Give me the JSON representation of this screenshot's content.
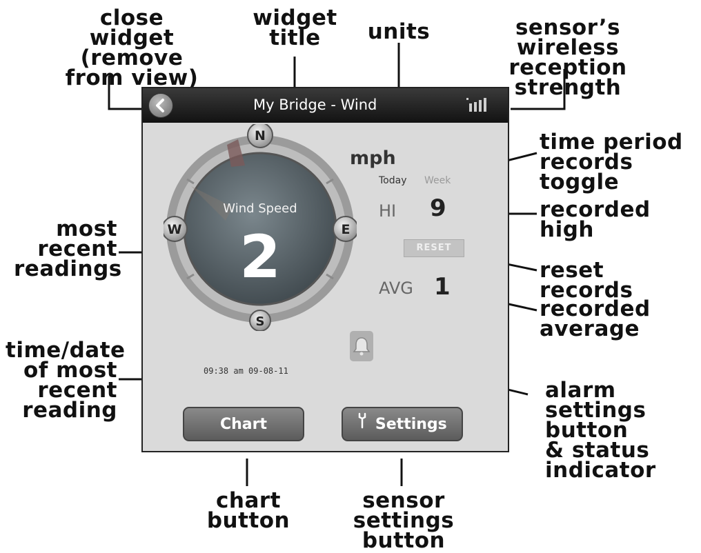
{
  "callouts": {
    "close_widget": [
      "close widget",
      "(remove",
      "from view)"
    ],
    "widget_title": [
      "widget",
      "title"
    ],
    "units": [
      "units"
    ],
    "reception": [
      "sensor’s wireless",
      "reception strength"
    ],
    "time_period": [
      "time period",
      "records toggle"
    ],
    "recorded_high": [
      "recorded",
      "high"
    ],
    "reset_records": [
      "reset records"
    ],
    "recorded_average": [
      "recorded",
      "average"
    ],
    "most_recent": [
      "most",
      "recent",
      "readings"
    ],
    "time_date": [
      "time/date",
      "of most",
      "recent",
      "reading"
    ],
    "alarm": [
      "alarm",
      "settings",
      "button",
      "& status",
      "indicator"
    ],
    "chart_button": [
      "chart",
      "button"
    ],
    "sensor_settings": [
      "sensor settings",
      "button"
    ]
  },
  "widget": {
    "title": "My Bridge - Wind",
    "units": "mph",
    "periods": [
      "Today",
      "Week"
    ],
    "selected_period": "Today",
    "hi_label": "HI",
    "hi_value": "9",
    "reset_label": "RESET",
    "avg_label": "AVG",
    "avg_value": "1",
    "dial": {
      "label": "Wind Speed",
      "value": "2",
      "compass": [
        "N",
        "E",
        "S",
        "W"
      ]
    },
    "timestamp": "09:38 am 09-08-11",
    "chart_label": "Chart",
    "settings_label": "Settings",
    "signal_bars": 4
  },
  "colors": {
    "titlebar": "#1c1c1c",
    "widget_bg": "#dadada",
    "dial_face": "#5f6a70",
    "button": "#6e6e6e"
  },
  "icons": [
    "back-arrow-icon",
    "signal-strength-icon",
    "bell-icon",
    "wrench-icon"
  ]
}
